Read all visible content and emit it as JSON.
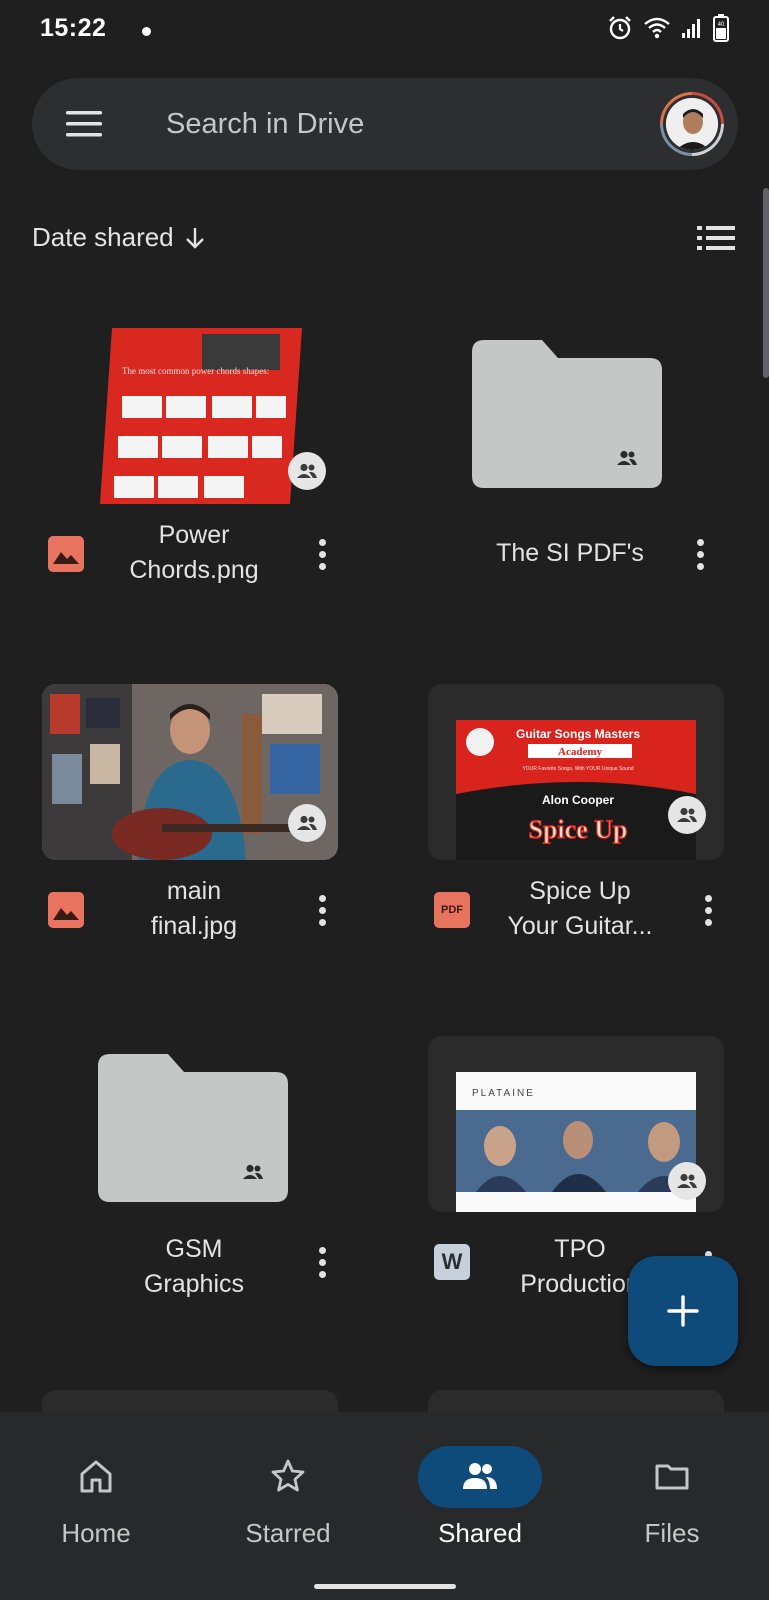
{
  "status_bar": {
    "time": "15:22",
    "battery": "40"
  },
  "search": {
    "placeholder": "Search in Drive"
  },
  "sort": {
    "label": "Date shared"
  },
  "files": [
    {
      "name_line1": "Power",
      "name_line2": "Chords.png",
      "type": "image",
      "thumb_text_1": "The most common power chords shapes:"
    },
    {
      "name": "The SI PDF's",
      "type": "folder"
    },
    {
      "name_line1": "main",
      "name_line2": "final.jpg",
      "type": "image"
    },
    {
      "name_line1": "Spice Up",
      "name_line2": "Your Guitar...",
      "type": "pdf",
      "thumb_title": "Guitar Songs Masters",
      "thumb_sub": "Academy",
      "thumb_tagline": "YOUR Favorite Songs, With YOUR Unique Sound",
      "thumb_author": "Alon Cooper",
      "thumb_big": "Spice Up",
      "badge_text": "PDF"
    },
    {
      "name_line1": "GSM",
      "name_line2": "Graphics",
      "type": "folder"
    },
    {
      "name_line1": "TPO",
      "name_line2": "Production",
      "type": "word",
      "thumb_brand": "PLATAINE",
      "badge_text": "W"
    }
  ],
  "nav": [
    {
      "label": "Home"
    },
    {
      "label": "Starred"
    },
    {
      "label": "Shared"
    },
    {
      "label": "Files"
    }
  ],
  "colors": {
    "accent": "#0e4a7a",
    "background": "#1f1f1f",
    "image_icon": "#e8735f",
    "pdf_icon": "#e8735f"
  }
}
